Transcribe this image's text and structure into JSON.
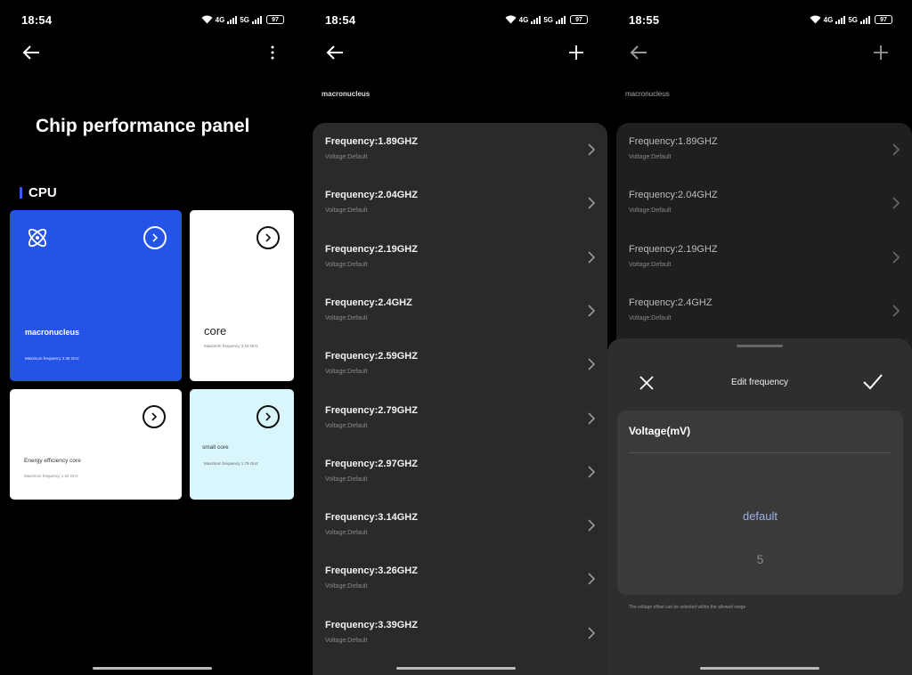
{
  "status_bars": [
    {
      "time": "18:54",
      "net1": "4G",
      "net2": "5G",
      "battery": "97"
    },
    {
      "time": "18:54",
      "net1": "4G",
      "net2": "5G",
      "battery": "97"
    },
    {
      "time": "18:55",
      "net1": "4G",
      "net2": "5G",
      "battery": "97"
    }
  ],
  "panel1": {
    "title": "Chip performance panel",
    "section": "CPU",
    "accent": "#3a5bff",
    "cards": [
      {
        "name": "macronucleus",
        "sub": "Maximum frequency 3.39 GHz",
        "bg": "#2553e6",
        "icon": "atom-icon"
      },
      {
        "name": "core",
        "sub": "Maximum frequency 3.19 GHz",
        "bg": "#ffffff"
      },
      {
        "name": "Energy efficiency core",
        "sub": "Maximum frequency 1.64 GHz",
        "bg": "#ffffff"
      },
      {
        "name": "small core",
        "sub": "Maximum frequency 1.79 GHz",
        "bg": "#d8f6fb"
      }
    ]
  },
  "panel2": {
    "subtitle": "macronucleus",
    "rows": [
      {
        "freq": "Frequency:1.89GHZ",
        "volt": "Voltage:Default"
      },
      {
        "freq": "Frequency:2.04GHZ",
        "volt": "Voltage:Default"
      },
      {
        "freq": "Frequency:2.19GHZ",
        "volt": "Voltage:Default"
      },
      {
        "freq": "Frequency:2.4GHZ",
        "volt": "Voltage:Default"
      },
      {
        "freq": "Frequency:2.59GHZ",
        "volt": "Voltage:Default"
      },
      {
        "freq": "Frequency:2.79GHZ",
        "volt": "Voltage:Default"
      },
      {
        "freq": "Frequency:2.97GHZ",
        "volt": "Voltage:Default"
      },
      {
        "freq": "Frequency:3.14GHZ",
        "volt": "Voltage:Default"
      },
      {
        "freq": "Frequency:3.26GHZ",
        "volt": "Voltage:Default"
      },
      {
        "freq": "Frequency:3.39GHZ",
        "volt": "Voltage:Default"
      }
    ]
  },
  "panel3": {
    "subtitle": "macronucleus",
    "rows": [
      {
        "freq": "Frequency:1.89GHZ",
        "volt": "Voltage:Default"
      },
      {
        "freq": "Frequency:2.04GHZ",
        "volt": "Voltage:Default"
      },
      {
        "freq": "Frequency:2.19GHZ",
        "volt": "Voltage:Default"
      },
      {
        "freq": "Frequency:2.4GHZ",
        "volt": "Voltage:Default"
      }
    ],
    "sheet": {
      "title": "Edit frequency",
      "field_label": "Voltage(mV)",
      "picker_selected": "default",
      "picker_next": "5",
      "hint": "The voltage offset can be selected within the allowed range"
    }
  }
}
